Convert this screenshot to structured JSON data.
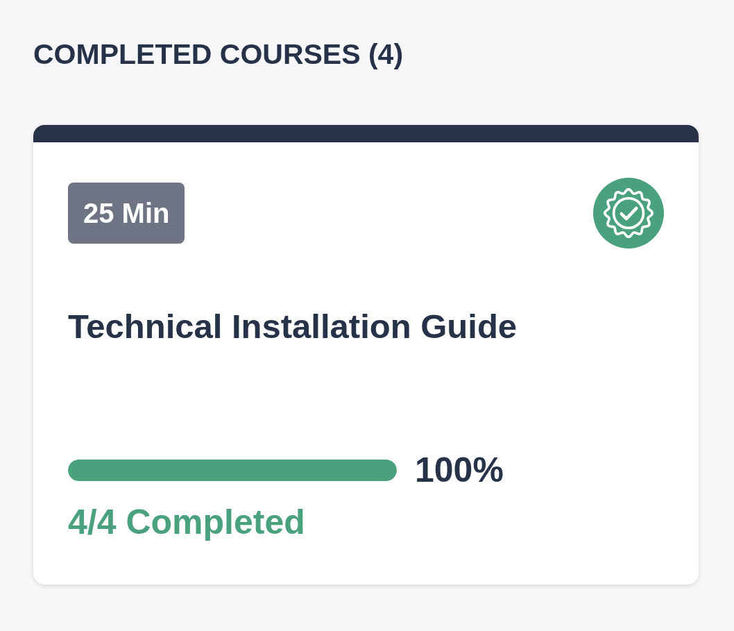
{
  "section": {
    "heading": "COMPLETED COURSES (4)"
  },
  "course_card": {
    "duration": "25 Min",
    "title": "Technical Installation Guide",
    "progress": {
      "level": 1,
      "reading": "100%"
    },
    "status_text": "4/4 Completed"
  }
}
